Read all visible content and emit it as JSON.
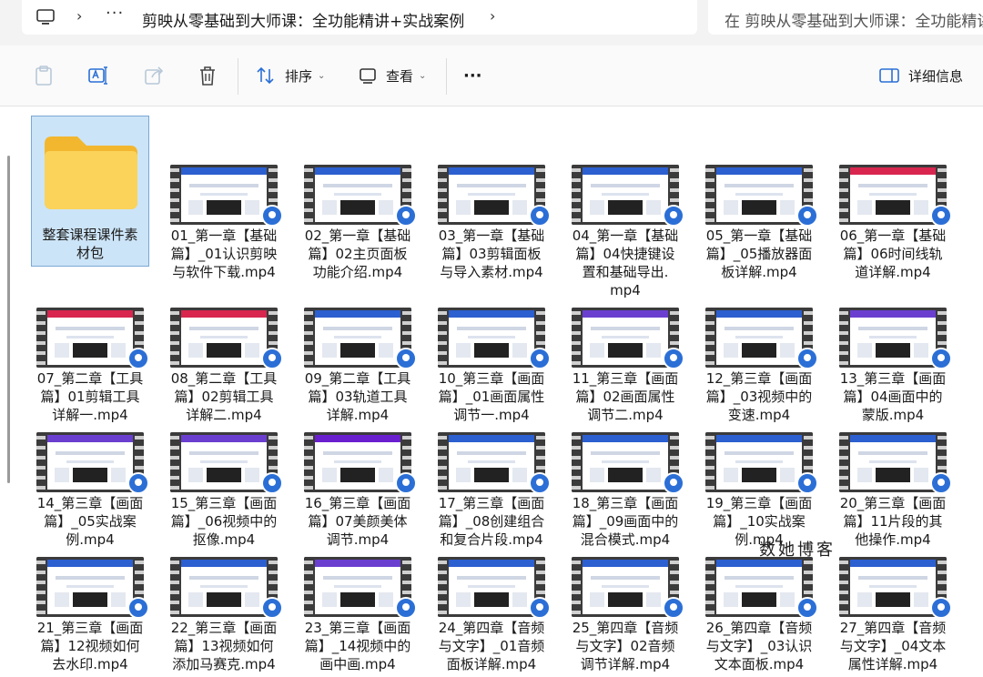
{
  "address_bar": {
    "chevron": "›",
    "ellipsis": "···",
    "path_title": "剪映从零基础到大师课：全功能精讲+实战案例",
    "search_placeholder": "在 剪映从零基础到大师课：全功能精讲+实战案例 中搜索"
  },
  "toolbar": {
    "sort_label": "排序",
    "view_label": "查看",
    "more_label": "···",
    "details_label": "详细信息"
  },
  "folder": {
    "name_line1": "整套课程课件素",
    "name_line2": "材包"
  },
  "files": [
    {
      "lines": [
        "01_第一章【基础",
        "篇】_01认识剪映",
        "与软件下载.mp4"
      ],
      "bar": "#2c5fd0"
    },
    {
      "lines": [
        "02_第一章【基础",
        "篇】02主页面板",
        "功能介绍.mp4"
      ],
      "bar": "#2c5fd0"
    },
    {
      "lines": [
        "03_第一章【基础",
        "篇】03剪辑面板",
        "与导入素材.mp4"
      ],
      "bar": "#2c5fd0"
    },
    {
      "lines": [
        "04_第一章【基础",
        "篇】04快捷键设",
        "置和基础导出.",
        "mp4"
      ],
      "bar": "#2c5fd0"
    },
    {
      "lines": [
        "05_第一章【基础",
        "篇】_05播放器面",
        "板详解.mp4"
      ],
      "bar": "#2c5fd0"
    },
    {
      "lines": [
        "06_第一章【基础",
        "篇】06时间线轨",
        "道详解.mp4"
      ],
      "bar": "#d8264f"
    },
    {
      "lines": [
        "07_第二章【工具",
        "篇】01剪辑工具",
        "详解一.mp4"
      ],
      "bar": "#d8264f"
    },
    {
      "lines": [
        "08_第二章【工具",
        "篇】02剪辑工具",
        "详解二.mp4"
      ],
      "bar": "#d8264f"
    },
    {
      "lines": [
        "09_第二章【工具",
        "篇】03轨道工具",
        "详解.mp4"
      ],
      "bar": "#2c5fd0"
    },
    {
      "lines": [
        "10_第三章【画面",
        "篇】_01画面属性",
        "调节一.mp4"
      ],
      "bar": "#2c5fd0"
    },
    {
      "lines": [
        "11_第三章【画面",
        "篇】02画面属性",
        "调节二.mp4"
      ],
      "bar": "#6a3fd0"
    },
    {
      "lines": [
        "12_第三章【画面",
        "篇】_03视频中的",
        "变速.mp4"
      ],
      "bar": "#2c5fd0"
    },
    {
      "lines": [
        "13_第三章【画面",
        "篇】04画面中的",
        "蒙版.mp4"
      ],
      "bar": "#6a3fd0"
    },
    {
      "lines": [
        "14_第三章【画面",
        "篇】_05实战案",
        "例.mp4"
      ],
      "bar": "#6a3fd0"
    },
    {
      "lines": [
        "15_第三章【画面",
        "篇】_06视频中的",
        "抠像.mp4"
      ],
      "bar": "#6a3fd0"
    },
    {
      "lines": [
        "16_第三章【画面",
        "篇】07美颜美体",
        "调节.mp4"
      ],
      "bar": "#6a1fcf"
    },
    {
      "lines": [
        "17_第三章【画面",
        "篇】_08创建组合",
        "和复合片段.mp4"
      ],
      "bar": "#2c5fd0"
    },
    {
      "lines": [
        "18_第三章【画面",
        "篇】_09画面中的",
        "混合模式.mp4"
      ],
      "bar": "#2c5fd0"
    },
    {
      "lines": [
        "19_第三章【画面",
        "篇】_10实战案",
        "例.mp4"
      ],
      "bar": "#2c5fd0"
    },
    {
      "lines": [
        "20_第三章【画面",
        "篇】11片段的其",
        "他操作.mp4"
      ],
      "bar": "#2c5fd0"
    },
    {
      "lines": [
        "21_第三章【画面",
        "篇】12视频如何",
        "去水印.mp4"
      ],
      "bar": "#2c5fd0"
    },
    {
      "lines": [
        "22_第三章【画面",
        "篇】13视频如何",
        "添加马赛克.mp4"
      ],
      "bar": "#2c5fd0"
    },
    {
      "lines": [
        "23_第三章【画面",
        "篇】_14视频中的",
        "画中画.mp4"
      ],
      "bar": "#6a3fd0"
    },
    {
      "lines": [
        "24_第四章【音频",
        "与文字】_01音频",
        "面板详解.mp4"
      ],
      "bar": "#2c5fd0"
    },
    {
      "lines": [
        "25_第四章【音频",
        "与文字】02音频",
        "调节详解.mp4"
      ],
      "bar": "#2c5fd0"
    },
    {
      "lines": [
        "26_第四章【音频",
        "与文字】_03认识",
        "文本面板.mp4"
      ],
      "bar": "#2c5fd0"
    },
    {
      "lines": [
        "27_第四章【音频",
        "与文字】_04文本",
        "属性详解.mp4"
      ],
      "bar": "#2c5fd0"
    }
  ],
  "watermark": "数她博客"
}
